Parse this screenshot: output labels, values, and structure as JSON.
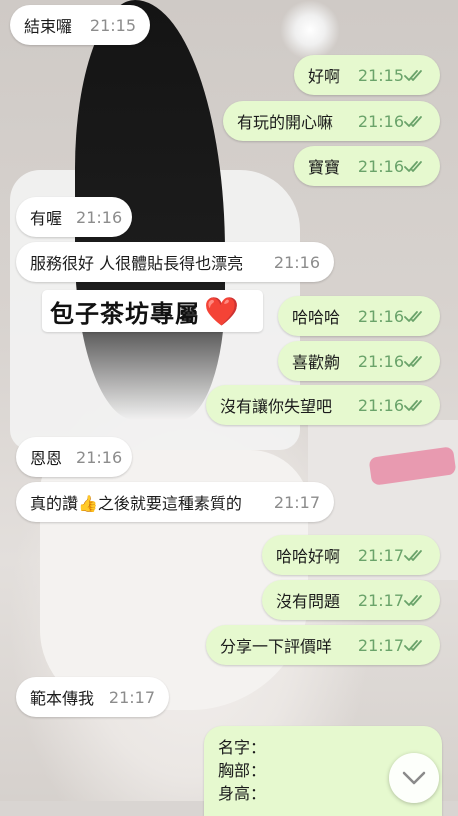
{
  "messages": [
    {
      "side": "in",
      "text": "結束囉",
      "time": "21:15"
    },
    {
      "side": "out",
      "text": "好啊",
      "time": "21:15"
    },
    {
      "side": "out",
      "text": "有玩的開心嘛",
      "time": "21:16"
    },
    {
      "side": "out",
      "text": "寶寶",
      "time": "21:16"
    },
    {
      "side": "in",
      "text": "有喔",
      "time": "21:16"
    },
    {
      "side": "in",
      "text": "服務很好 人很體貼長得也漂亮",
      "time": "21:16"
    },
    {
      "side": "out",
      "text": "哈哈哈",
      "time": "21:16"
    },
    {
      "side": "out",
      "text": "喜歡齁",
      "time": "21:16"
    },
    {
      "side": "out",
      "text": "沒有讓你失望吧",
      "time": "21:16"
    },
    {
      "side": "in",
      "text": "恩恩",
      "time": "21:16"
    },
    {
      "side": "in",
      "text": "真的讚👍之後就要這種素質的",
      "time": "21:17"
    },
    {
      "side": "out",
      "text": "哈哈好啊",
      "time": "21:17"
    },
    {
      "side": "out",
      "text": "沒有問題",
      "time": "21:17"
    },
    {
      "side": "out",
      "text": "分享一下評價咩",
      "time": "21:17"
    },
    {
      "side": "in",
      "text": "範本傳我",
      "time": "21:17"
    }
  ],
  "overlay_tag": {
    "text": "包子茶坊專屬",
    "emoji": "❤️"
  },
  "form_card": {
    "lines": [
      "名字：",
      "胸部：",
      "身高："
    ]
  },
  "colors": {
    "incoming": "#ffffff",
    "outgoing": "#e6f9cf",
    "tick": "#6aa36a"
  },
  "icons": {
    "read_receipt": "double-check-icon",
    "scroll": "chevron-down-icon"
  }
}
